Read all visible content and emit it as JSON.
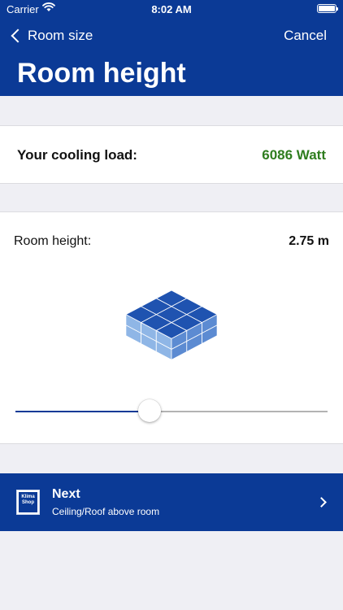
{
  "status_bar": {
    "carrier": "Carrier",
    "time": "8:02 AM"
  },
  "nav": {
    "back_label": "Room size",
    "cancel_label": "Cancel",
    "title": "Room height"
  },
  "cooling_load": {
    "label": "Your cooling load:",
    "value": "6086 Watt",
    "value_color": "#2f7d1f"
  },
  "room_height": {
    "label": "Room height:",
    "value": "2.75 m",
    "slider_fraction": 0.43
  },
  "next": {
    "logo_text": "Klima Shop",
    "title": "Next",
    "subtitle": "Ceiling/Roof above room"
  },
  "colors": {
    "brand_blue": "#0b3a96",
    "background": "#efeff4"
  },
  "icons": [
    "wifi-icon",
    "battery-icon",
    "back-chevron-icon",
    "cubes-illustration",
    "next-chevron-icon",
    "klimashop-logo"
  ]
}
